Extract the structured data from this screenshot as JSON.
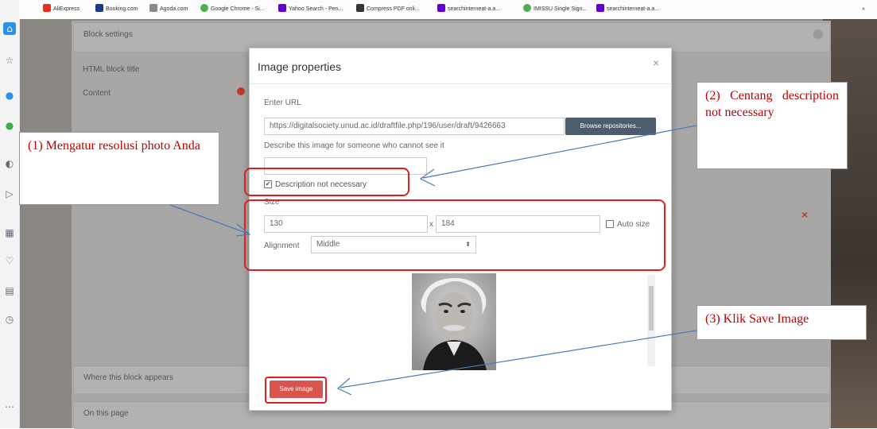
{
  "bookmarks": [
    {
      "label": "AliExpress",
      "color": "#e43225"
    },
    {
      "label": "Booking.com",
      "color": "#1a3b8b"
    },
    {
      "label": "Agoda.com",
      "color": "#888888"
    },
    {
      "label": "Google Chrome - Si...",
      "color": "#4caf50"
    },
    {
      "label": "Yahoo Search - Pen...",
      "color": "#6001d2"
    },
    {
      "label": "Compress PDF onli...",
      "color": "#333333"
    },
    {
      "label": "searchinterneat-a.a...",
      "color": "#6001d2"
    },
    {
      "label": "IMISSU Single Sign...",
      "color": "#4caf50"
    },
    {
      "label": "searchinterneat-a.a...",
      "color": "#6001d2"
    }
  ],
  "background": {
    "block_settings": "Block settings",
    "html_block_title": "HTML block title",
    "content": "Content",
    "where_appears": "Where this block appears",
    "on_this_page": "On this page",
    "remove_mark": "×"
  },
  "modal": {
    "title": "Image properties",
    "close": "×",
    "enter_url_label": "Enter URL",
    "url_value": "https://digitalsociety.unud.ac.id/draftfile.php/196/user/draft/9426663",
    "browse_button": "Browse repositories...",
    "describe_label": "Describe this image for someone who cannot see it",
    "describe_value": "",
    "description_not_necessary": "Description not necessary",
    "description_checked": true,
    "size_label": "Size",
    "width": "130",
    "times": "x",
    "height": "184",
    "auto_size": "Auto size",
    "alignment_label": "Alignment",
    "alignment_value": "Middle",
    "save_button": "Save image"
  },
  "callouts": {
    "step1": "(1) Mengatur resolusi photo  Anda",
    "step2": "(2) Centang description not necessary",
    "step3": "(3) Klik Save Image"
  },
  "colors": {
    "annotation_red": "#e31b23",
    "callout_text": "#c00000",
    "arrow_blue": "#4a7ab5",
    "save_button": "#d9534f",
    "browse_button": "#4b5c6d"
  }
}
